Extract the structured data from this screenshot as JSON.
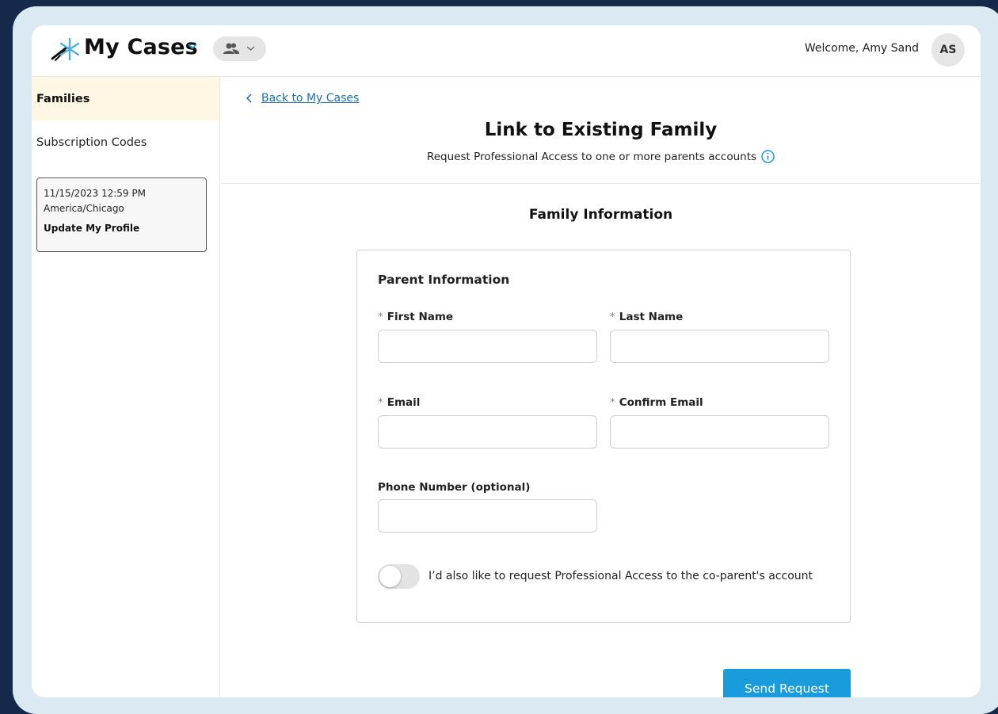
{
  "header": {
    "app_title": "My Cases",
    "welcome_text": "Welcome, Amy Sand",
    "avatar_initials": "AS"
  },
  "sidebar": {
    "items": [
      {
        "label": "Families",
        "active": true
      },
      {
        "label": "Subscription Codes",
        "active": false
      }
    ],
    "profile_card": {
      "datetime": "11/15/2023 12:59 PM",
      "timezone": "America/Chicago",
      "update_label": "Update My Profile"
    }
  },
  "main": {
    "back_link": "Back to My Cases",
    "title": "Link to Existing Family",
    "subtitle": "Request Professional Access to one or more parents accounts",
    "section_title": "Family Information",
    "form": {
      "card_title": "Parent Information",
      "required_marker": "*",
      "fields": {
        "first_name": {
          "label": "First Name",
          "value": ""
        },
        "last_name": {
          "label": "Last Name",
          "value": ""
        },
        "email": {
          "label": "Email",
          "value": ""
        },
        "confirm_email": {
          "label": "Confirm Email",
          "value": ""
        },
        "phone": {
          "label": "Phone Number (optional)",
          "value": ""
        }
      },
      "coparent_toggle": {
        "label": "I’d also like to request Professional Access to the co-parent's account",
        "on": false
      }
    },
    "send_button": "Send Request"
  },
  "colors": {
    "outer_background": "#15294a",
    "frame_background": "#dbe9f3",
    "accent_blue": "#1a9cdc",
    "link_blue": "#1b6fb7",
    "active_sidebar": "#fdf7e3",
    "logo_light_blue": "#4fb0e0"
  },
  "icons": [
    "logo-icon",
    "chevron-down-icon",
    "people-icon",
    "chevron-left-icon",
    "info-icon"
  ]
}
